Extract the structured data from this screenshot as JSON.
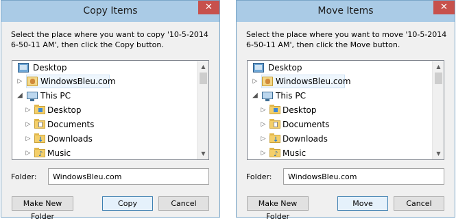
{
  "copy_dialog": {
    "title": "Copy Items",
    "close": "✕",
    "prompt_line1": "Select the place where you want to copy '10-5-2014",
    "prompt_line2": "6-50-11 AM', then click the Copy button.",
    "tree": [
      {
        "label": "Desktop",
        "icon": "desktop-icon"
      },
      {
        "label": "WindowsBleu.com",
        "icon": "user-folder-icon",
        "arrow": "▷"
      },
      {
        "label": "This PC",
        "icon": "computer-icon",
        "arrow": "◢"
      },
      {
        "label": "Desktop",
        "icon": "folder-icon",
        "arrow": "▷"
      },
      {
        "label": "Documents",
        "icon": "documents-folder-icon",
        "arrow": "▷"
      },
      {
        "label": "Downloads",
        "icon": "downloads-folder-icon",
        "arrow": "▷"
      },
      {
        "label": "Music",
        "icon": "music-folder-icon",
        "arrow": "▷"
      }
    ],
    "folder_label": "Folder:",
    "folder_value": "WindowsBleu.com",
    "make_new_folder": "Make New Folder",
    "action": "Copy",
    "cancel": "Cancel"
  },
  "move_dialog": {
    "title": "Move Items",
    "close": "✕",
    "prompt_line1": "Select the place where you want to move '10-5-2014",
    "prompt_line2": "6-50-11 AM', then click the Move button.",
    "tree": [
      {
        "label": "Desktop",
        "icon": "desktop-icon"
      },
      {
        "label": "WindowsBleu.com",
        "icon": "user-folder-icon",
        "arrow": "▷"
      },
      {
        "label": "This PC",
        "icon": "computer-icon",
        "arrow": "◢"
      },
      {
        "label": "Desktop",
        "icon": "folder-icon",
        "arrow": "▷"
      },
      {
        "label": "Documents",
        "icon": "documents-folder-icon",
        "arrow": "▷"
      },
      {
        "label": "Downloads",
        "icon": "downloads-folder-icon",
        "arrow": "▷"
      },
      {
        "label": "Music",
        "icon": "music-folder-icon",
        "arrow": "▷"
      }
    ],
    "folder_label": "Folder:",
    "folder_value": "WindowsBleu.com",
    "make_new_folder": "Make New Folder",
    "action": "Move",
    "cancel": "Cancel"
  },
  "scrollbar": {
    "up": "▲",
    "down": "▼"
  },
  "colors": {
    "titlebar": "#aacbe6",
    "close": "#c7514c",
    "primary_border": "#3c7fb1"
  }
}
